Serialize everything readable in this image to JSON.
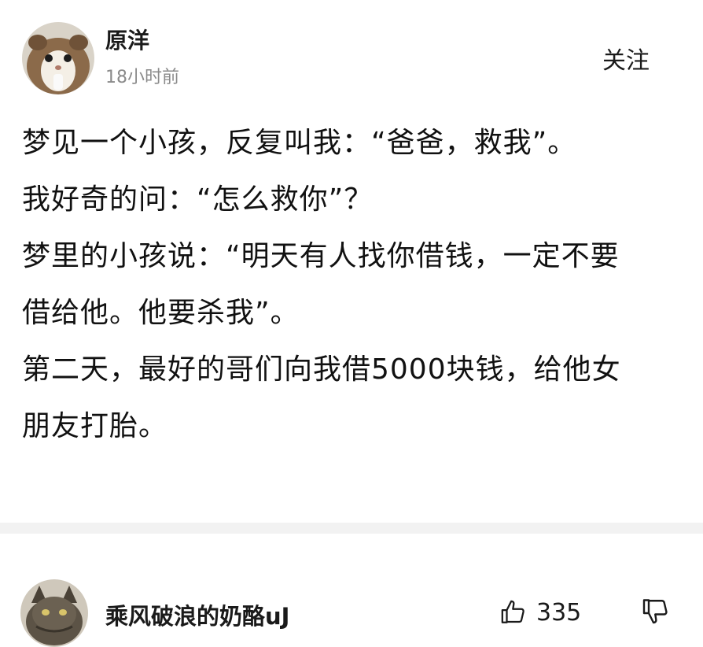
{
  "post": {
    "author": {
      "name": "原洋",
      "time": "18小时前",
      "avatar_icon": "hamster-avatar"
    },
    "follow_label": "关注",
    "lines": [
      "梦见一个小孩，反复叫我：“爸爸，救我”。",
      "我好奇的问：“怎么救你”？",
      "梦里的小孩说：“明天有人找你借钱，一定不要",
      "借给他。他要杀我”。",
      "第二天，最好的哥们向我借5000块钱，给他女",
      "朋友打胎。"
    ]
  },
  "comment": {
    "username": "乘风破浪的奶酪uJ",
    "avatar_icon": "cat-avatar",
    "likes": "335",
    "like_icon": "thumbs-up-icon",
    "dislike_icon": "thumbs-down-icon"
  },
  "colors": {
    "text": "#1a1a1a",
    "muted": "#8a8a8a",
    "divider": "#f2f2f2"
  }
}
